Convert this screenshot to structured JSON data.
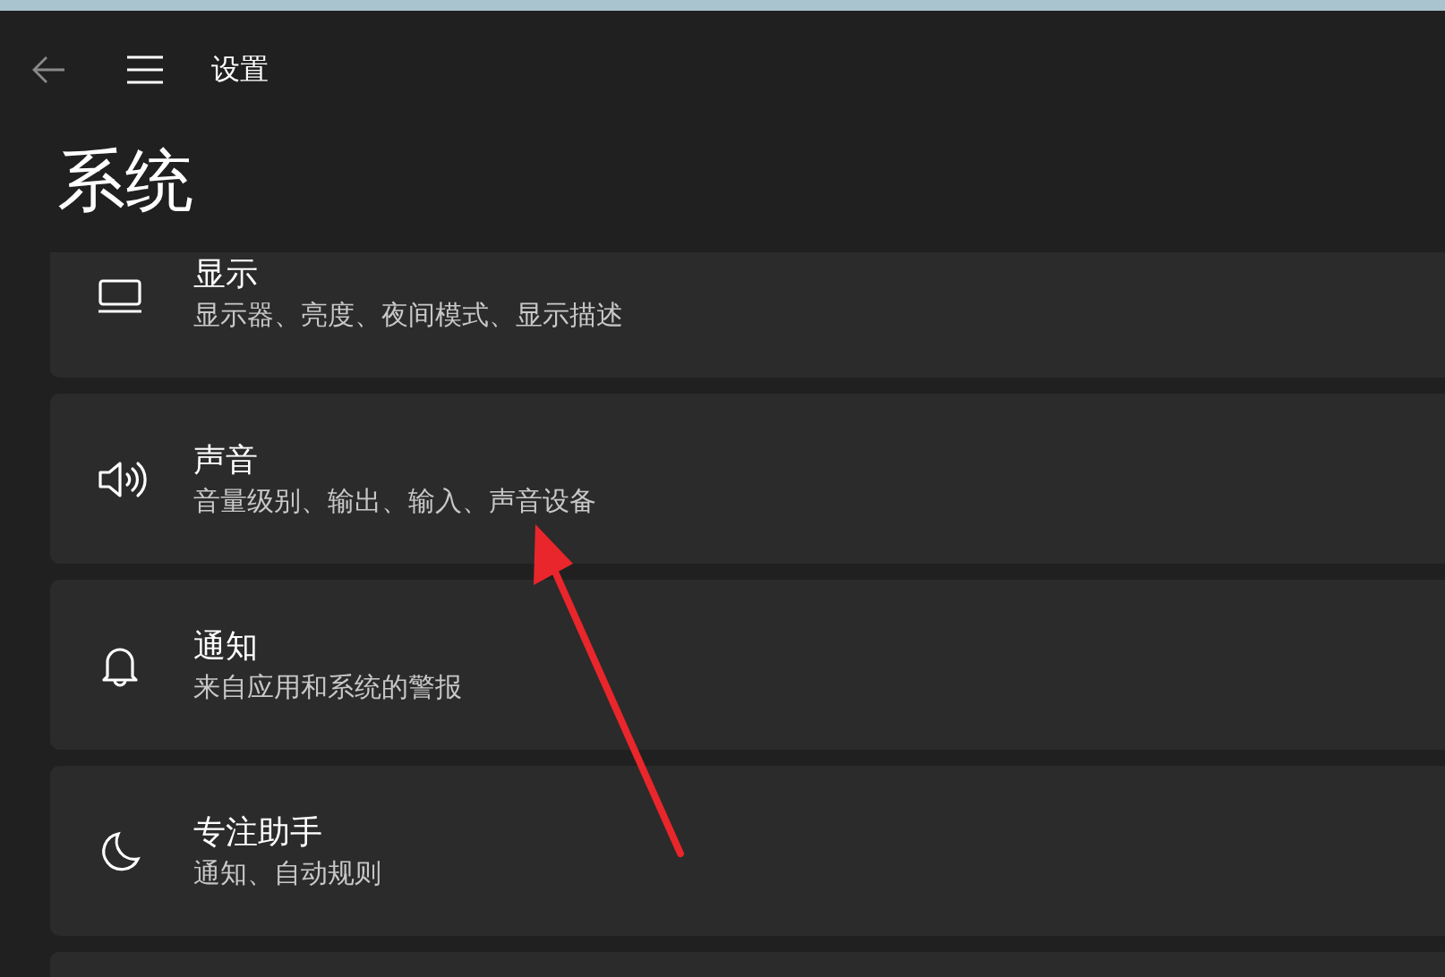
{
  "window": {
    "title": "设置"
  },
  "page_title": "系统",
  "items": [
    {
      "kind": "display",
      "title": "显示",
      "subtitle": "显示器、亮度、夜间模式、显示描述"
    },
    {
      "kind": "sound",
      "title": "声音",
      "subtitle": "音量级别、输出、输入、声音设备"
    },
    {
      "kind": "notifications",
      "title": "通知",
      "subtitle": "来自应用和系统的警报"
    },
    {
      "kind": "focus",
      "title": "专注助手",
      "subtitle": "通知、自动规则"
    },
    {
      "kind": "empty"
    }
  ]
}
